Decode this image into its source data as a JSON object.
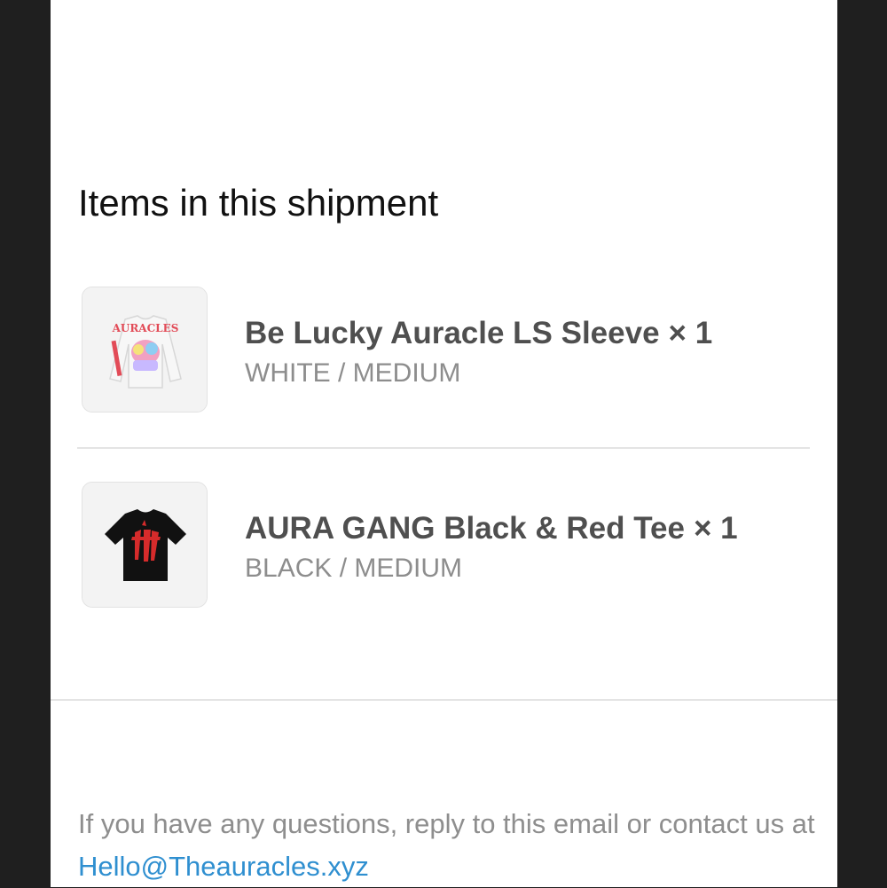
{
  "section": {
    "title": "Items in this shipment"
  },
  "items": [
    {
      "name": "Be Lucky Auracle LS Sleeve",
      "quantity": "× 1",
      "variant": "WHITE / MEDIUM",
      "thumbnail_icon": "white-long-sleeve-shirt-icon",
      "thumbnail_colors": {
        "shirt": "#f7f7f7",
        "graphic": "#e24b57"
      }
    },
    {
      "name": "AURA GANG Black & Red Tee",
      "quantity": "× 1",
      "variant": "BLACK / MEDIUM",
      "thumbnail_icon": "black-tee-shirt-icon",
      "thumbnail_colors": {
        "shirt": "#111111",
        "graphic": "#d62b2b"
      }
    }
  ],
  "footer": {
    "text": "If you have any questions, reply to this email or contact us at",
    "email_link": "Hello@Theauracles.xyz",
    "link_color": "#2f8fd0"
  }
}
